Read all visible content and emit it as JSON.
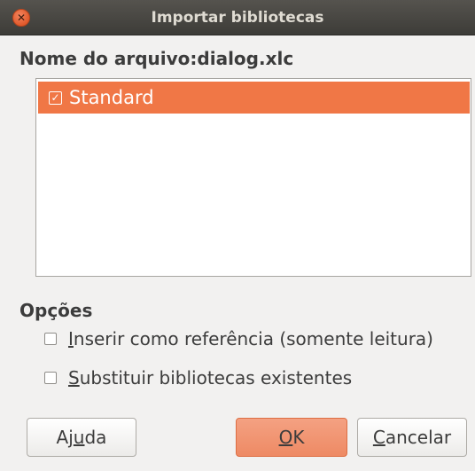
{
  "window": {
    "title": "Importar bibliotecas",
    "close_glyph": "✕"
  },
  "file": {
    "label": "Nome do arquivo:dialog.xlc"
  },
  "libraries": [
    {
      "label": "Standard",
      "checked": true,
      "selected": true
    }
  ],
  "options": {
    "title": "Opções",
    "items": [
      {
        "label": "Inserir como referência (somente leitura)",
        "mnemonic": "I",
        "checked": false
      },
      {
        "label": "Substituir bibliotecas existentes",
        "mnemonic": "S",
        "checked": false
      }
    ]
  },
  "buttons": {
    "help": "Ajuda",
    "ok": "OK",
    "cancel": "Cancelar"
  },
  "colors": {
    "accent": "#f07746",
    "titlebar": "#3d3c38",
    "background": "#f2f1f0"
  }
}
